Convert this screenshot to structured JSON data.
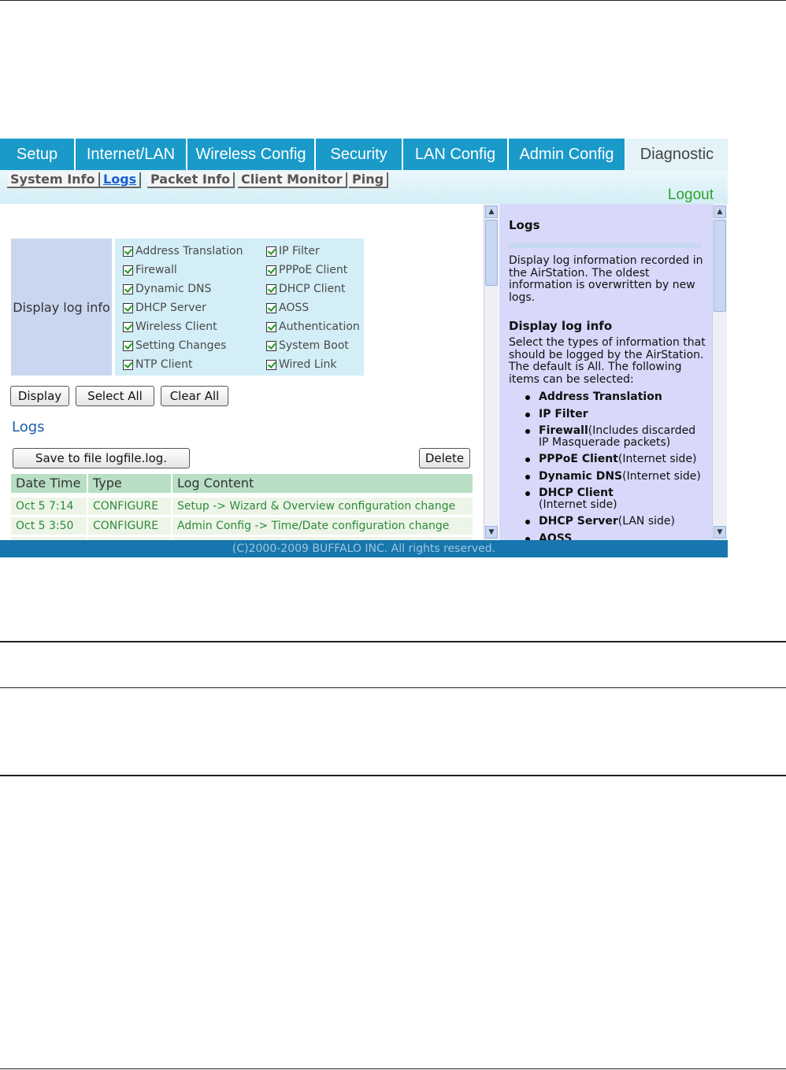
{
  "tabs": [
    {
      "label": "Setup"
    },
    {
      "label": "Internet/LAN"
    },
    {
      "label": "Wireless Config"
    },
    {
      "label": "Security"
    },
    {
      "label": "LAN Config"
    },
    {
      "label": "Admin Config"
    },
    {
      "label": "Diagnostic"
    }
  ],
  "subnav": [
    {
      "label": "System Info"
    },
    {
      "label": "Logs"
    },
    {
      "label": "Packet Info"
    },
    {
      "label": "Client Monitor"
    },
    {
      "label": "Ping"
    }
  ],
  "logout_label": "Logout",
  "display_log_info": {
    "label": "Display log info",
    "options": [
      {
        "label": "Address Translation",
        "checked": true
      },
      {
        "label": "IP Filter",
        "checked": true
      },
      {
        "label": "Firewall",
        "checked": true
      },
      {
        "label": "PPPoE Client",
        "checked": true
      },
      {
        "label": "Dynamic DNS",
        "checked": true
      },
      {
        "label": "DHCP Client",
        "checked": true
      },
      {
        "label": "DHCP Server",
        "checked": true
      },
      {
        "label": "AOSS",
        "checked": true
      },
      {
        "label": "Wireless Client",
        "checked": true
      },
      {
        "label": "Authentication",
        "checked": true
      },
      {
        "label": "Setting Changes",
        "checked": true
      },
      {
        "label": "System Boot",
        "checked": true
      },
      {
        "label": "NTP Client",
        "checked": true
      },
      {
        "label": "Wired Link",
        "checked": true
      }
    ]
  },
  "buttons": {
    "display": "Display",
    "select_all": "Select All",
    "clear_all": "Clear All",
    "save": "Save to file logfile.log.",
    "delete": "Delete"
  },
  "logs_heading": "Logs",
  "log_table": {
    "headers": [
      "Date Time",
      "Type",
      "Log Content"
    ],
    "rows": [
      [
        "Oct 5 7:14",
        "CONFIGURE",
        "Setup -> Wizard & Overview configuration change"
      ],
      [
        "Oct 5 3:50",
        "CONFIGURE",
        "Admin Config -> Time/Date configuration change"
      ]
    ]
  },
  "help": {
    "title": "Logs",
    "intro": "Display log information recorded in the AirStation. The oldest information is overwritten by new logs.",
    "section_title": "Display log info",
    "section_text": "Select the types of information that should be logged by the AirStation. The default is All. The following items can be selected:",
    "items": [
      {
        "bold": "Address Translation",
        "rest": ""
      },
      {
        "bold": "IP Filter",
        "rest": ""
      },
      {
        "bold": "Firewall",
        "rest": "(Includes discarded IP Masquerade packets)"
      },
      {
        "bold": "PPPoE Client",
        "rest": "(Internet side)"
      },
      {
        "bold": "Dynamic DNS",
        "rest": "(Internet side)"
      },
      {
        "bold": "DHCP Client",
        "rest": "(Internet side)"
      },
      {
        "bold": "DHCP Server",
        "rest": "(LAN side)"
      },
      {
        "bold": "AOSS",
        "rest": ""
      }
    ]
  },
  "footer": "(C)2000-2009 BUFFALO INC. All rights reserved."
}
